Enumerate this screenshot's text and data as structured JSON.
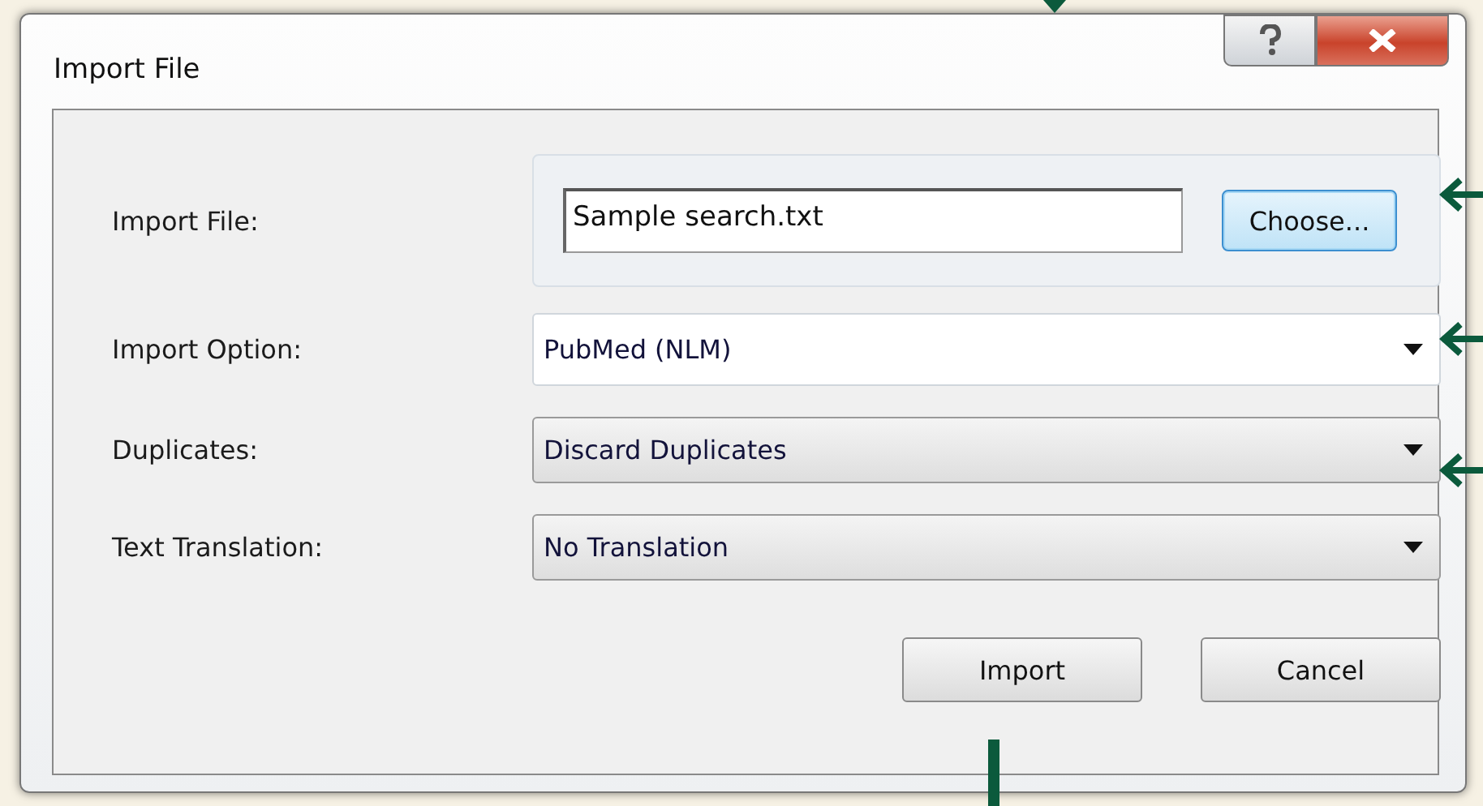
{
  "window": {
    "title": "Import File"
  },
  "title_buttons": [
    {
      "kind": "help"
    },
    {
      "kind": "close"
    }
  ],
  "import_file": {
    "label": "Import File:",
    "value": "Sample search.txt",
    "button": "Choose..."
  },
  "options": [
    {
      "label": "Import Option:",
      "value": "PubMed (NLM)",
      "kind": "editable"
    },
    {
      "label": "Duplicates:",
      "value": "Discard Duplicates",
      "kind": "dropdown"
    },
    {
      "label": "Text Translation:",
      "value": "No Translation",
      "kind": "dropdown"
    }
  ],
  "buttons": [
    "Import",
    "Cancel"
  ]
}
